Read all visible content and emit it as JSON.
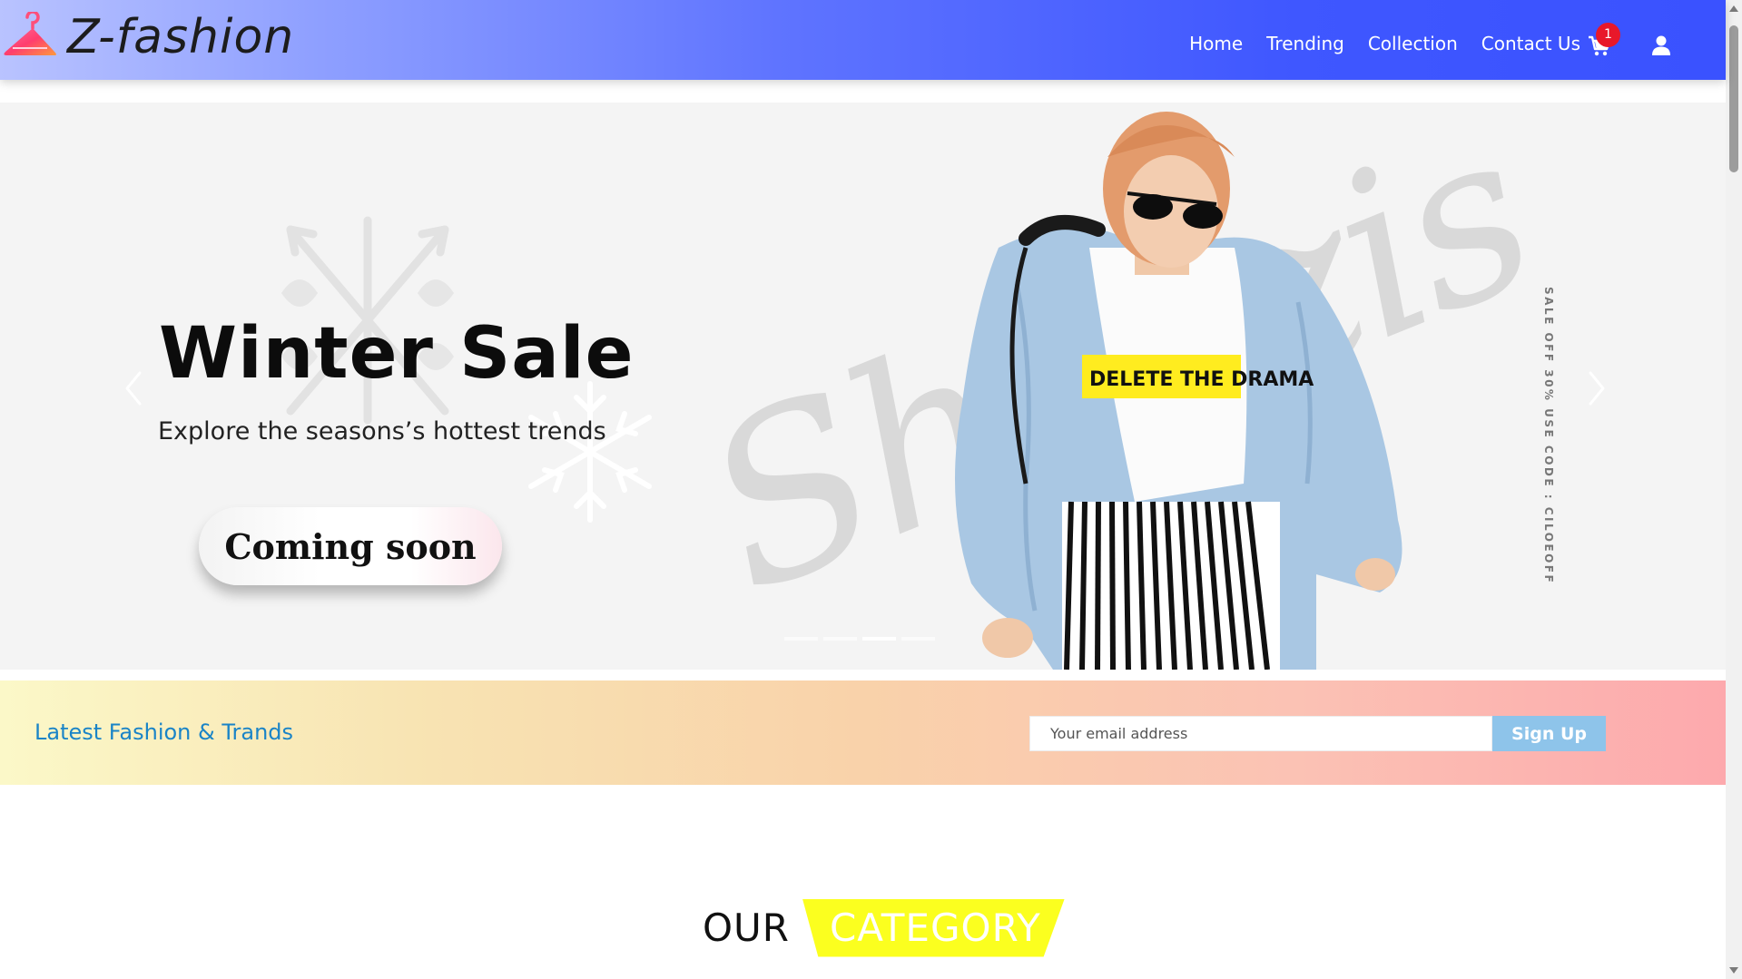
{
  "brand": {
    "name": "Z-fashion",
    "logo_icon": "hanger-icon"
  },
  "nav": {
    "links": [
      "Home",
      "Trending",
      "Collection",
      "Contact Us"
    ],
    "cart_count": "1",
    "cart_icon": "cart-icon",
    "user_icon": "user-icon"
  },
  "hero": {
    "title": "Winter Sale",
    "subtitle": "Explore the seasons’s hottest trends",
    "button_label": "Coming soon",
    "vertical_text": "SALE OFF 30% USE CODE : CILOEOFF",
    "watermark": "Shopzis",
    "shirt_text": "DELETE THE DRAMA",
    "slides_count": 4,
    "active_slide": 3
  },
  "newsletter": {
    "title": "Latest Fashion & Trands",
    "email_placeholder": "Your email address",
    "email_value": "",
    "signup_label": "Sign Up"
  },
  "category_heading": {
    "part1": "OUR",
    "part2": "CATEGORY"
  },
  "colors": {
    "nav_gradient_start": "#b9c3ff",
    "nav_gradient_end": "#3a52ff",
    "cart_badge": "#e8182a",
    "newsletter_title": "#1a84c7",
    "signup_button": "#8ec4ea",
    "category_highlight": "#fbff1f"
  }
}
